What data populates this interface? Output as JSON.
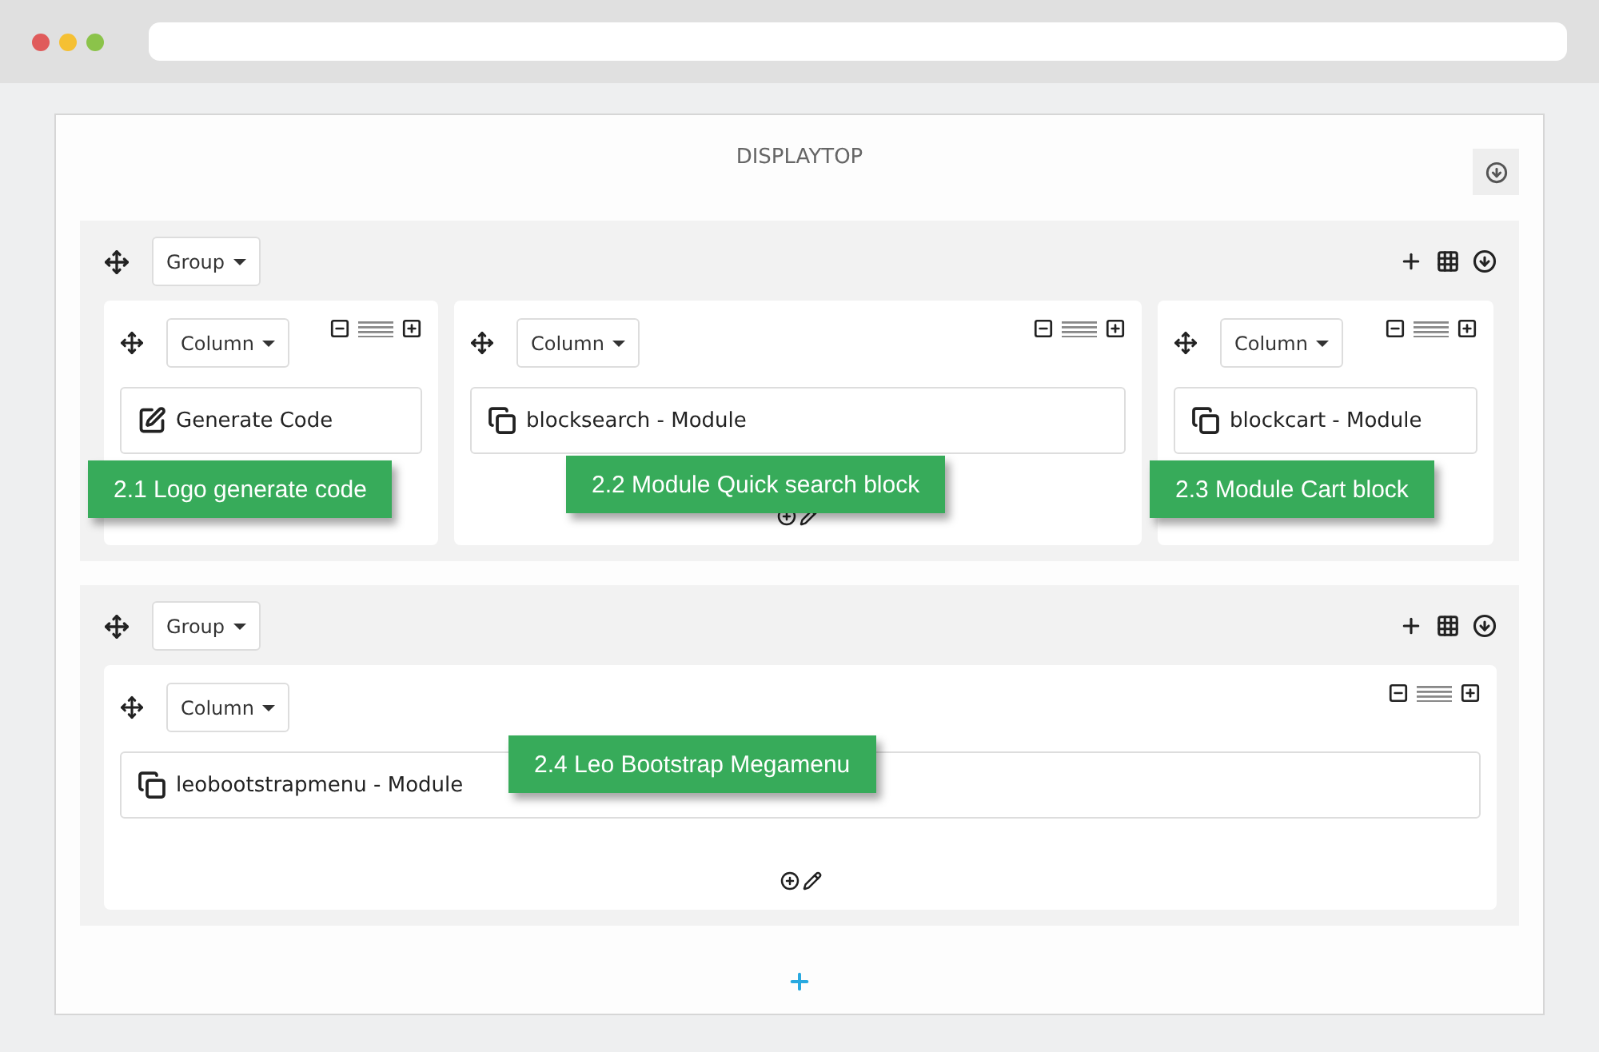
{
  "section": {
    "title": "DISPLAYTOP"
  },
  "groups": [
    {
      "label": "Group",
      "columns": [
        {
          "label": "Column",
          "module": {
            "kind": "code",
            "text": "Generate Code"
          },
          "callout": "2.1 Logo generate code",
          "footer_tools": false
        },
        {
          "label": "Column",
          "module": {
            "kind": "module",
            "text": "blocksearch - Module"
          },
          "callout": "2.2 Module Quick search block",
          "footer_tools": true
        },
        {
          "label": "Column",
          "module": {
            "kind": "module",
            "text": "blockcart - Module"
          },
          "callout": "2.3 Module Cart block",
          "footer_tools": false
        }
      ]
    },
    {
      "label": "Group",
      "columns": [
        {
          "label": "Column",
          "module": {
            "kind": "module",
            "text": "leobootstrapmenu - Module"
          },
          "callout": "2.4 Leo Bootstrap Megamenu",
          "footer_tools": true
        }
      ]
    }
  ]
}
